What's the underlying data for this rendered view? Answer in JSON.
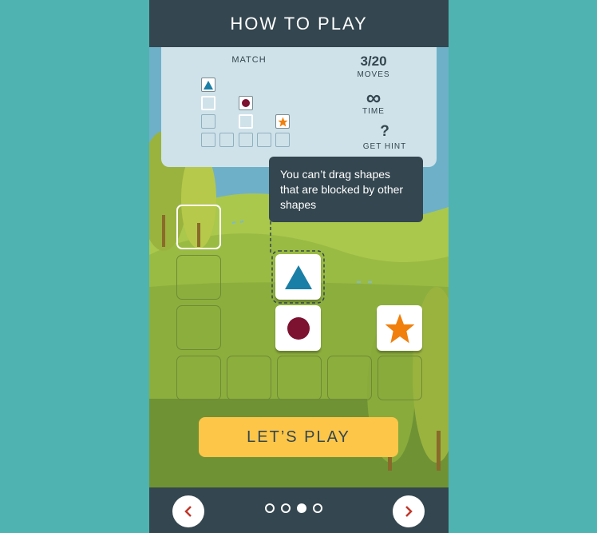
{
  "header": {
    "title": "HOW TO PLAY"
  },
  "panel": {
    "match_label": "MATCH",
    "moves_value": "3/20",
    "moves_label": "MOVES",
    "time_symbol": "∞",
    "time_label": "TIME",
    "hint_symbol": "?",
    "hint_label": "GET HINT"
  },
  "tooltip": {
    "text": "You can’t drag shapes that are blocked by other shapes"
  },
  "cta": {
    "label": "LET’S PLAY"
  },
  "pagination": {
    "total": 4,
    "current": 3
  },
  "colors": {
    "dark": "#34464f",
    "background": "#4fb3b1",
    "cta": "#fdc649",
    "triangle": "#1a7fa6",
    "circle": "#7d1130",
    "star": "#f07f0c",
    "nav_arrow": "#c0392b"
  },
  "icons": {
    "prev": "chevron-left-icon",
    "next": "chevron-right-icon",
    "time": "infinity-icon",
    "hint": "question-icon"
  }
}
